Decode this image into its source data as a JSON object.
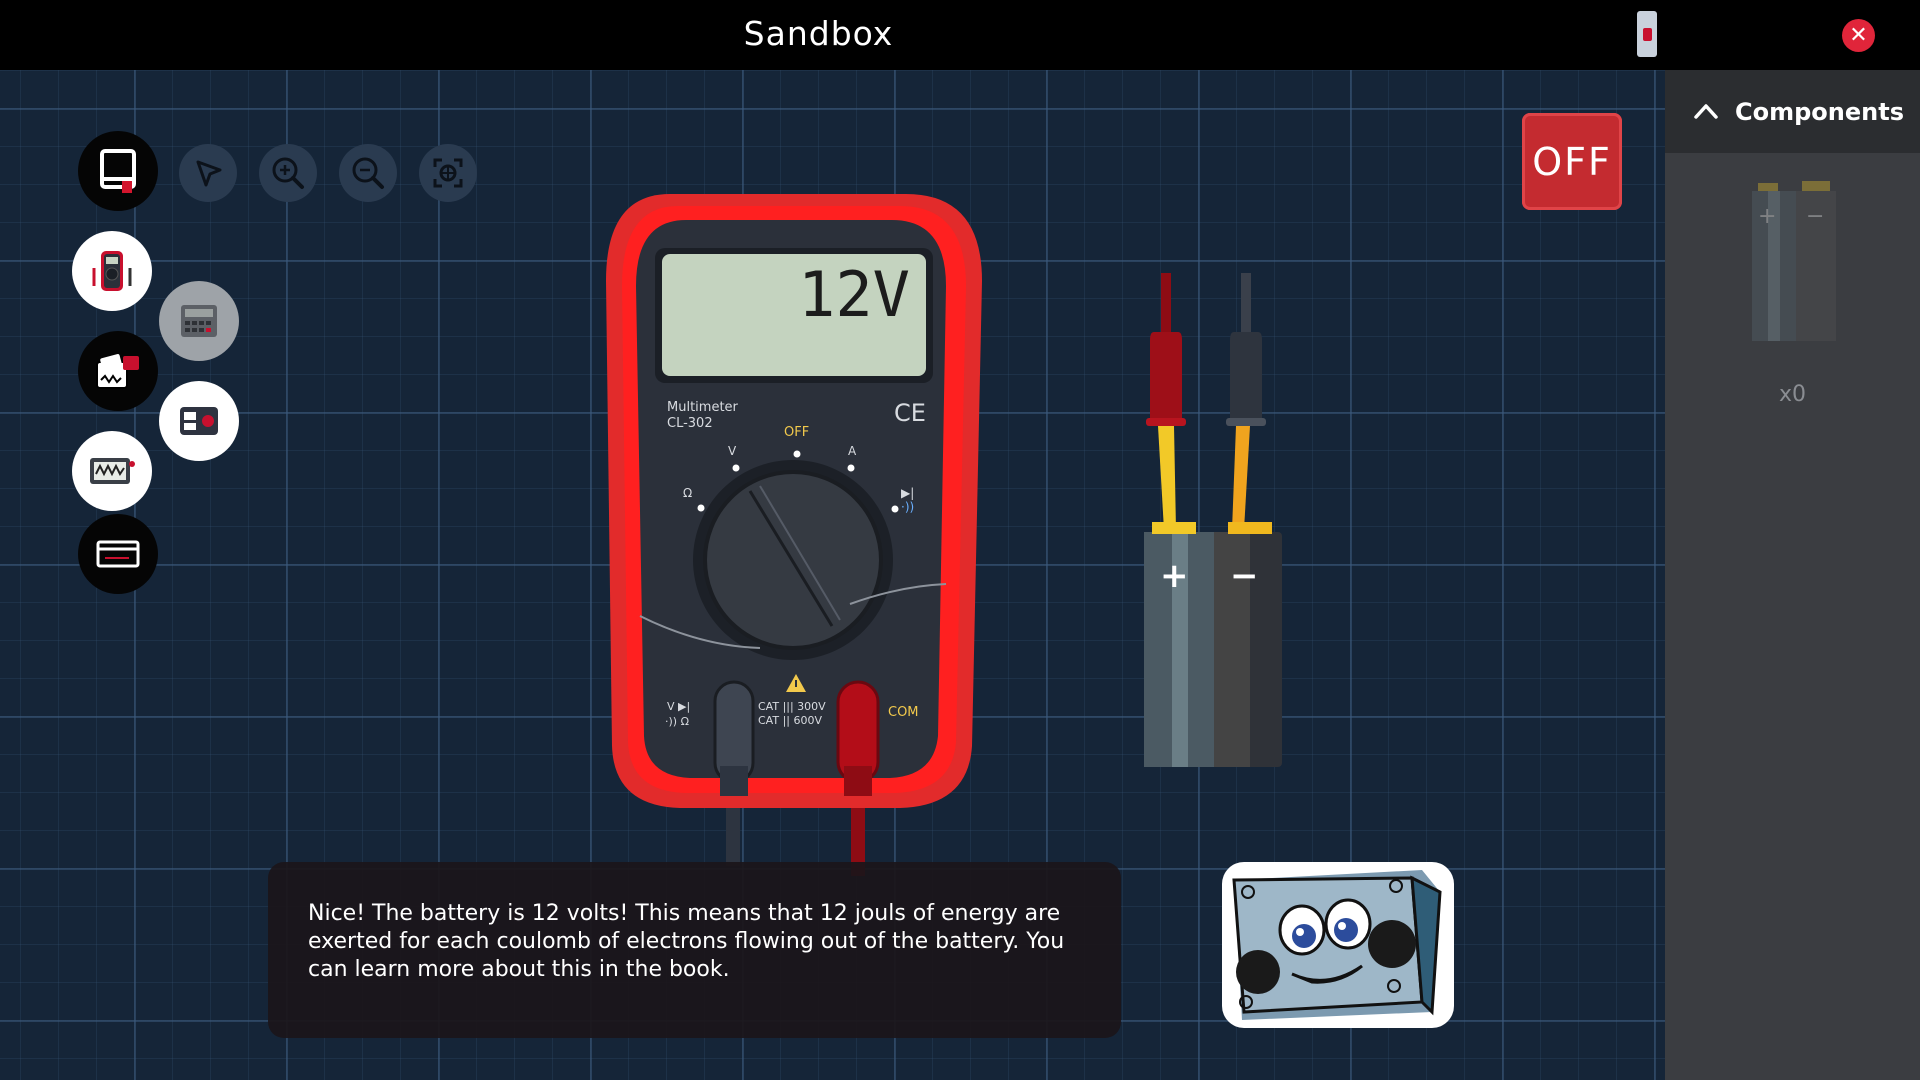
{
  "window": {
    "title": "Sandbox"
  },
  "panel": {
    "header": "Components",
    "item_count": "x0"
  },
  "power_button": {
    "label": "OFF"
  },
  "multimeter": {
    "display": "12V",
    "model_line1": "Multimeter",
    "model_line2": "CL-302",
    "ce_mark": "CE",
    "dial_off": "OFF",
    "dial_v": "V",
    "dial_a": "A",
    "dial_ohm": "Ω",
    "rating_line1": "CAT ||| 300V",
    "rating_line2": "CAT || 600V",
    "jack_left_top": "V  ▶|",
    "jack_left_bottom": "·))  Ω",
    "jack_com": "COM"
  },
  "battery": {
    "plus": "+",
    "minus": "−"
  },
  "dialogue": {
    "text": "Nice! The battery is 12 volts! This means that 12 jouls of energy are exerted for each coulomb of electrons flowing out of the battery. You can learn more about this in the book."
  },
  "icons": {
    "book": "book-icon",
    "select": "pointer-icon",
    "zoom_in": "zoom-in-icon",
    "zoom_out": "zoom-out-icon",
    "fit": "fit-view-icon"
  },
  "colors": {
    "accent_red": "#e0253a",
    "panel_bg": "#3b3d41",
    "grid_bg": "#152538"
  }
}
